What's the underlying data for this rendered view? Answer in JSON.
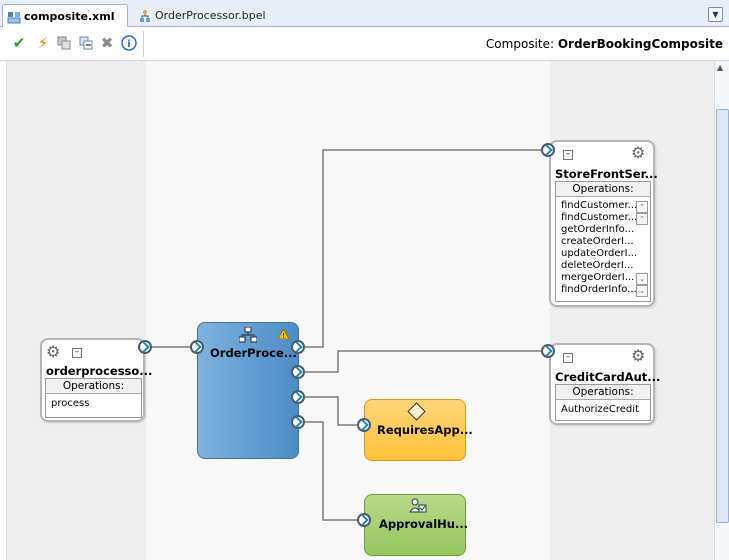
{
  "tabs": [
    {
      "label": "composite.xml",
      "icon": "composite-icon",
      "active": true
    },
    {
      "label": "OrderProcessor.bpel",
      "icon": "bpel-process-icon",
      "active": false
    }
  ],
  "toolbar": {
    "buttons": [
      "validate-check-icon",
      "lightning-icon",
      "copy-icon",
      "remove-icon",
      "delete-x-icon",
      "info-icon"
    ],
    "composite_label": "Composite:",
    "composite_name": "OrderBookingComposite"
  },
  "services": [
    {
      "name": "orderprocesso...",
      "ops_header": "Operations:",
      "operations": [
        "process"
      ]
    }
  ],
  "components": {
    "bpel": {
      "name": "OrderProce...",
      "warning": true
    },
    "rules": {
      "name": "RequiresApp..."
    },
    "human_task": {
      "name": "ApprovalHu..."
    }
  },
  "references": [
    {
      "name": "StoreFrontSer...",
      "ops_header": "Operations:",
      "operations": [
        "findCustomer...",
        "findCustomer...",
        "getOrderInfo...",
        "createOrderI...",
        "updateOrderI...",
        "deleteOrderI...",
        "mergeOrderI...",
        "findOrderInfo..."
      ]
    },
    {
      "name": "CreditCardAut...",
      "ops_header": "Operations:",
      "operations": [
        "AuthorizeCredit"
      ]
    }
  ],
  "colors": {
    "bpel": "#6fa6d8",
    "rules": "#ffc84a",
    "human_task": "#a3cd6f",
    "wire": "#7a7a7a",
    "port_chevron": "#1a8aa8"
  }
}
